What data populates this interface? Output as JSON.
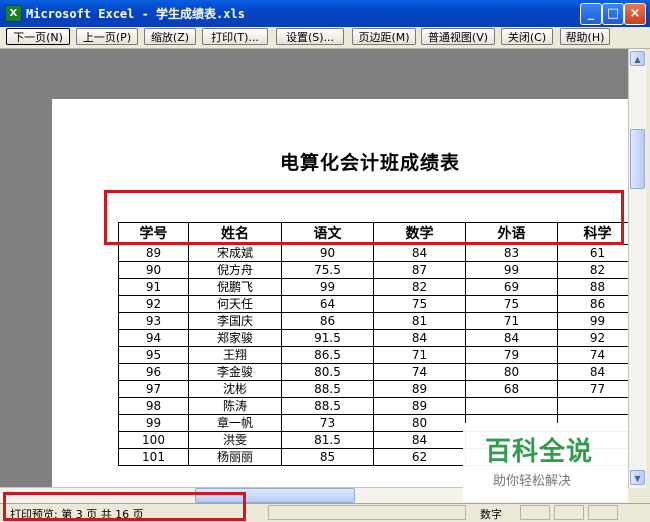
{
  "window": {
    "title": "Microsoft Excel - 学生成绩表.xls",
    "min_label": "_",
    "max_label": "□",
    "close_label": "×"
  },
  "toolbar": {
    "buttons": [
      {
        "label": "下一页(N)"
      },
      {
        "label": "上一页(P)"
      },
      {
        "label": "缩放(Z)"
      },
      {
        "label": "打印(T)..."
      },
      {
        "label": "设置(S)..."
      },
      {
        "label": "页边距(M)"
      },
      {
        "label": "普通视图(V)"
      },
      {
        "label": "关闭(C)"
      },
      {
        "label": "帮助(H)"
      }
    ]
  },
  "sheet": {
    "title": "电算化会计班成绩表",
    "headers": [
      "学号",
      "姓名",
      "语文",
      "数学",
      "外语",
      "科学"
    ],
    "rows": [
      [
        "89",
        "宋成斌",
        "90",
        "84",
        "83",
        "61"
      ],
      [
        "90",
        "倪方舟",
        "75.5",
        "87",
        "99",
        "82"
      ],
      [
        "91",
        "倪鹏飞",
        "99",
        "82",
        "69",
        "88"
      ],
      [
        "92",
        "何天任",
        "64",
        "75",
        "75",
        "86"
      ],
      [
        "93",
        "李国庆",
        "86",
        "81",
        "71",
        "99"
      ],
      [
        "94",
        "郑家骏",
        "91.5",
        "84",
        "84",
        "92"
      ],
      [
        "95",
        "王翔",
        "86.5",
        "71",
        "79",
        "74"
      ],
      [
        "96",
        "李金骏",
        "80.5",
        "74",
        "80",
        "84"
      ],
      [
        "97",
        "沈彬",
        "88.5",
        "89",
        "68",
        "77"
      ],
      [
        "98",
        "陈涛",
        "88.5",
        "89",
        "",
        ""
      ],
      [
        "99",
        "章一帆",
        "73",
        "80",
        "",
        ""
      ],
      [
        "100",
        "洪雯",
        "81.5",
        "84",
        "",
        ""
      ],
      [
        "101",
        "杨丽丽",
        "85",
        "62",
        "",
        ""
      ]
    ]
  },
  "statusbar": {
    "text": "打印预览: 第 3 页  共 16 页",
    "mode": "数字"
  },
  "watermark": {
    "main": "百科全说",
    "sub": "助你轻松解决"
  },
  "colors": {
    "highlight": "#d0161e",
    "watermark_green": "#2f9d4b",
    "titlebar_blue": "#0a5fe0"
  }
}
